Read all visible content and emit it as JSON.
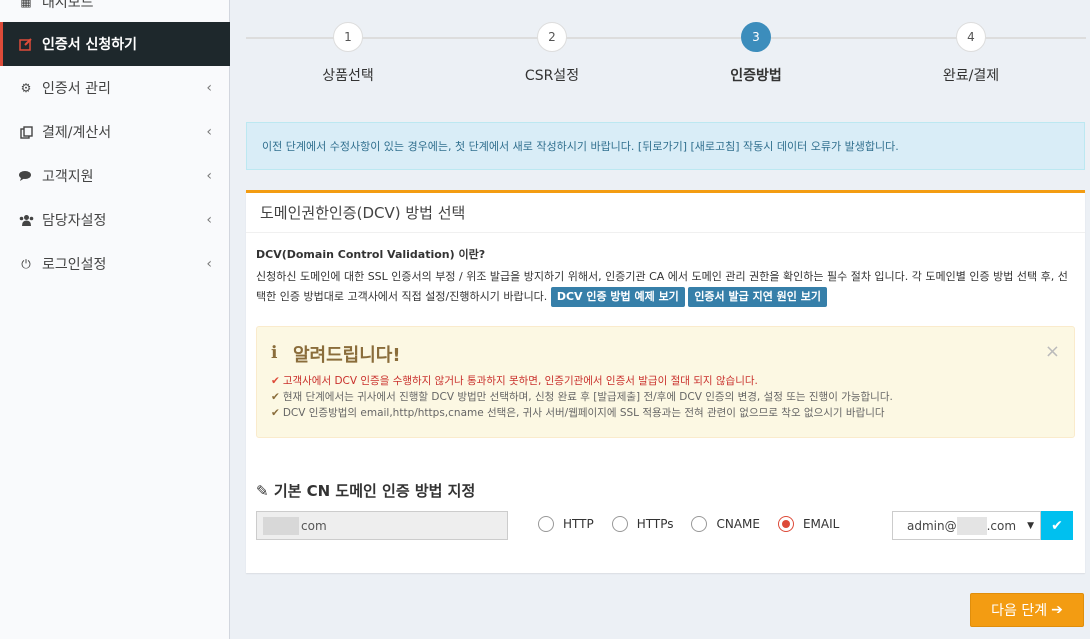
{
  "sidebar": {
    "items": [
      {
        "label": "대시보드",
        "icon": "dashboard-icon"
      },
      {
        "label": "인증서 신청하기",
        "icon": "edit-icon"
      },
      {
        "label": "인증서 관리",
        "icon": "gears-icon"
      },
      {
        "label": "결제/계산서",
        "icon": "copy-icon"
      },
      {
        "label": "고객지원",
        "icon": "comments-icon"
      },
      {
        "label": "담당자설정",
        "icon": "users-icon"
      },
      {
        "label": "로그인설정",
        "icon": "power-icon"
      }
    ],
    "chevron": "‹"
  },
  "steps": [
    {
      "num": "1",
      "label": "상품선택"
    },
    {
      "num": "2",
      "label": "CSR설정"
    },
    {
      "num": "3",
      "label": "인증방법"
    },
    {
      "num": "4",
      "label": "완료/결제"
    }
  ],
  "current_step": 3,
  "info_text": "이전 단계에서 수정사항이 있는 경우에는, 첫 단계에서 새로 작성하시기 바랍니다. [뒤로가기] [새로고침] 작동시 데이터 오류가 발생합니다.",
  "box": {
    "title": "도메인권한인증(DCV) 방법 선택",
    "dcv_heading": "DCV(Domain Control Validation) 이란?",
    "dcv_desc": "신청하신 도메인에 대한 SSL 인증서의 부정 / 위조 발급을 방지하기 위해서, 인증기관 CA 에서 도메인 관리 권한을 확인하는 필수 절차 입니다. 각 도메인별 인증 방법 선택 후, 선택한 인증 방법대로 고객사에서 직접 설정/진행하시기 바랍니다.",
    "btn_examples": "DCV 인증 방법 예제 보기",
    "btn_delay": "인증서 발급 지연 원인 보기"
  },
  "notice": {
    "title": "알려드립니다!",
    "close": "×",
    "items": [
      "고객사에서 DCV 인증을 수행하지 않거나 통과하지 못하면, 인증기관에서 인증서 발급이 절대 되지 않습니다.",
      "현재 단계에서는 귀사에서 진행할 DCV 방법만 선택하며, 신청 완료 후 [발급제출] 전/후에 DCV 인증의 변경, 설정 또는 진행이 가능합니다.",
      "DCV 인증방법의 email,http/https,cname 선택은, 귀사 서버/웹페이지에 SSL 적용과는 전혀 관련이 없으므로 착오 없으시기 바랍니다"
    ]
  },
  "cn": {
    "title": "기본 CN 도메인 인증 방법 지정",
    "domain_suffix": "com",
    "radios": [
      "HTTP",
      "HTTPs",
      "CNAME",
      "EMAIL"
    ],
    "selected": "EMAIL",
    "email_prefix": "admin@",
    "email_suffix": ".com"
  },
  "next_label": "다음 단계"
}
